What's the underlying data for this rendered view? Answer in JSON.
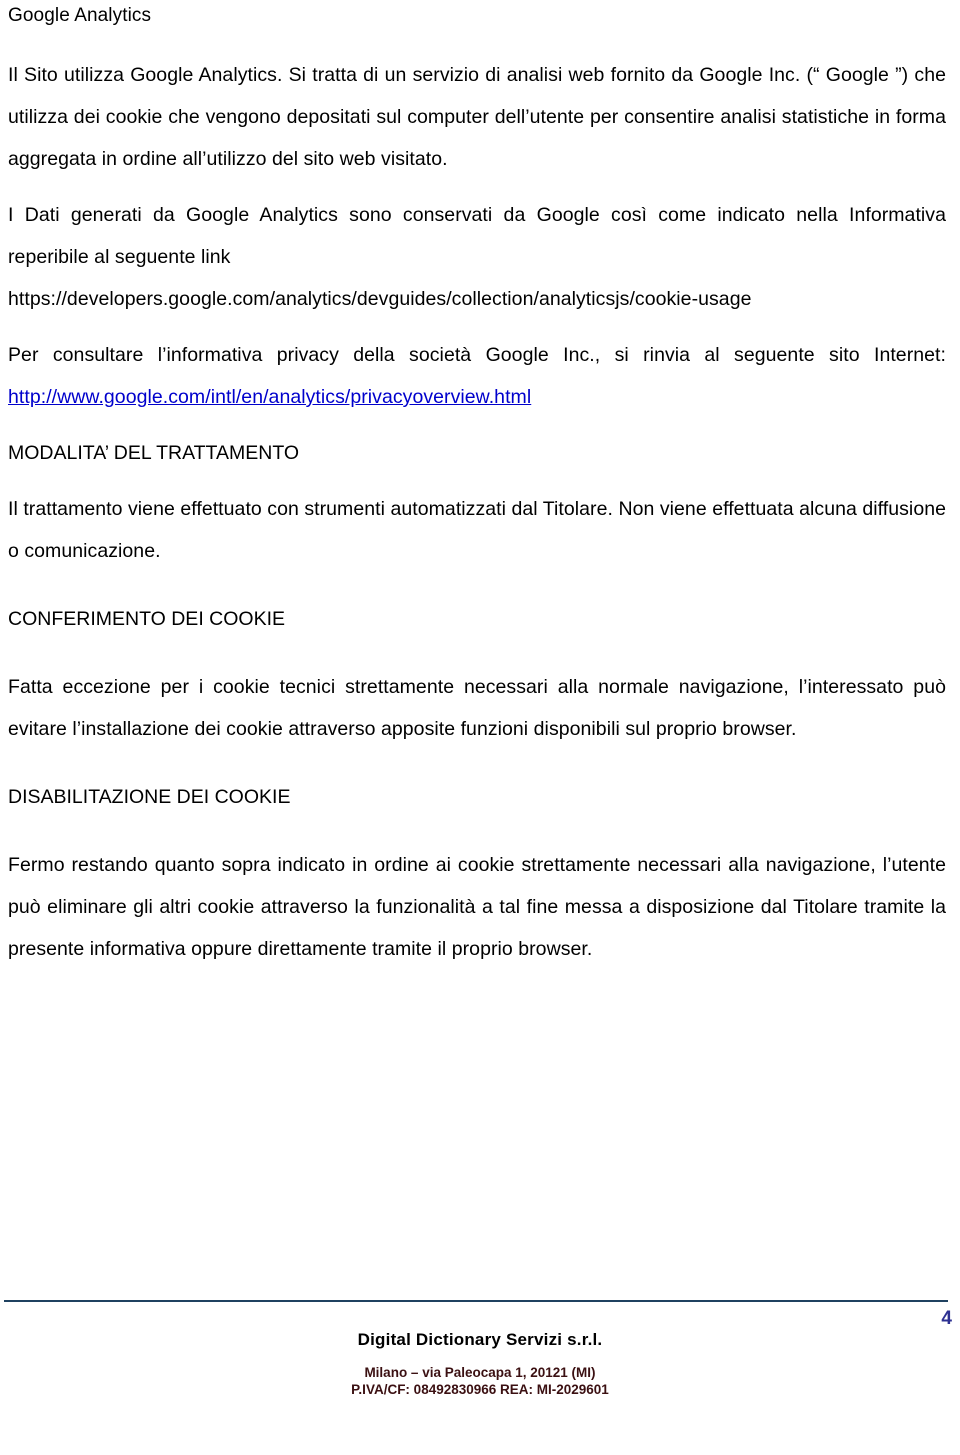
{
  "document": {
    "title": "Google Analytics",
    "paragraphs": {
      "p1": "Il Sito utilizza Google Analytics. Si tratta di un servizio di analisi web fornito da Google Inc. (“ Google ”) che utilizza dei cookie che vengono depositati sul computer dell’utente per consentire analisi statistiche in forma aggregata in ordine all’utilizzo del sito web visitato.",
      "p2_before_link": "I Dati generati da Google Analytics sono conservati da Google così come indicato nella Informativa reperibile al seguente link",
      "p2_url": "https://developers.google.com/analytics/devguides/collection/analyticsjs/cookie-usage",
      "p3_before_link": "Per consultare l’informativa privacy della società Google Inc., si rinvia al seguente sito Internet: ",
      "p3_link": "http://www.google.com/intl/en/analytics/privacyoverview.html",
      "p4": "Il trattamento viene effettuato con strumenti automatizzati dal Titolare. Non viene effettuata alcuna diffusione o comunicazione.",
      "p5": "Fatta eccezione per i cookie tecnici strettamente necessari alla normale navigazione, l’interessato può evitare l’installazione dei cookie attraverso apposite funzioni disponibili sul proprio browser.",
      "p6": "Fermo restando quanto sopra indicato in ordine ai cookie strettamente necessari alla navigazione, l’utente può eliminare gli altri cookie attraverso la funzionalità a tal fine messa a disposizione dal Titolare tramite la presente informativa oppure direttamente tramite il proprio browser."
    },
    "headings": {
      "h1": "MODALITA’ DEL TRATTAMENTO",
      "h2": "CONFERIMENTO DEI COOKIE",
      "h3": "DISABILITAZIONE DEI COOKIE"
    }
  },
  "footer": {
    "page_number": "4",
    "company": "Digital Dictionary Servizi s.r.l.",
    "address_line1": "Milano – via Paleocapa 1, 20121 (MI)",
    "address_line2": "P.IVA/CF: 08492830966 REA: MI-2029601"
  },
  "colors": {
    "link": "#0000CC",
    "footer_rule": "#1F4160",
    "page_number": "#2E3192",
    "footer_address": "#3B1012",
    "text": "#000000",
    "background": "#FFFFFF"
  }
}
